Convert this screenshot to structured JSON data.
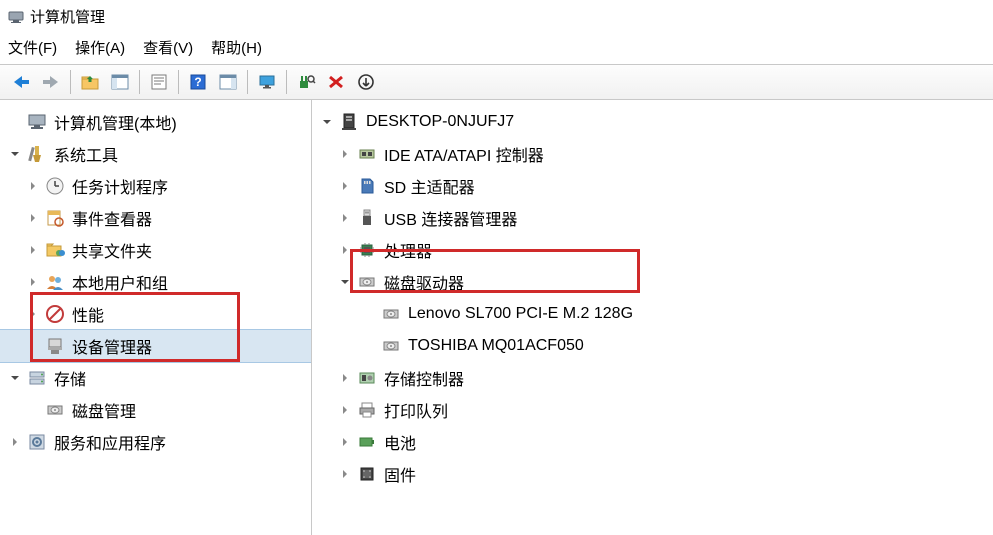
{
  "window": {
    "title": "计算机管理"
  },
  "menu": {
    "file": "文件(F)",
    "action": "操作(A)",
    "view": "查看(V)",
    "help": "帮助(H)"
  },
  "left_tree": {
    "root": "计算机管理(本地)",
    "system_tools": "系统工具",
    "task_scheduler": "任务计划程序",
    "event_viewer": "事件查看器",
    "shared_folders": "共享文件夹",
    "local_users": "本地用户和组",
    "performance": "性能",
    "device_manager": "设备管理器",
    "storage": "存储",
    "disk_management": "磁盘管理",
    "services_apps": "服务和应用程序"
  },
  "right_tree": {
    "computer": "DESKTOP-0NJUFJ7",
    "ide": "IDE ATA/ATAPI 控制器",
    "sd": "SD 主适配器",
    "usb": "USB 连接器管理器",
    "cpu": "处理器",
    "disk_drives": "磁盘驱动器",
    "disk1": "Lenovo SL700 PCI-E M.2 128G",
    "disk2": "TOSHIBA MQ01ACF050",
    "storage_ctrl": "存储控制器",
    "print_queue": "打印队列",
    "battery": "电池",
    "firmware": "固件"
  }
}
